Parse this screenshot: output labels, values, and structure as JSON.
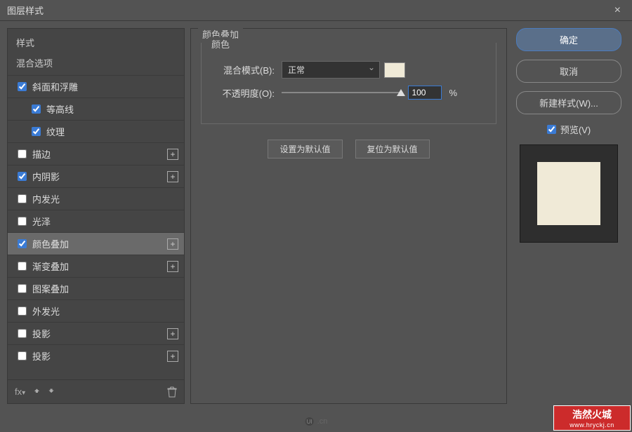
{
  "titlebar": {
    "title": "图层样式"
  },
  "sidebar": {
    "header": "样式",
    "blendOptions": "混合选项",
    "items": [
      {
        "label": "斜面和浮雕",
        "checked": true,
        "addable": false,
        "indent": 0
      },
      {
        "label": "等高线",
        "checked": true,
        "addable": false,
        "indent": 1
      },
      {
        "label": "纹理",
        "checked": true,
        "addable": false,
        "indent": 1
      },
      {
        "label": "描边",
        "checked": false,
        "addable": true,
        "indent": 0
      },
      {
        "label": "内阴影",
        "checked": true,
        "addable": true,
        "indent": 0
      },
      {
        "label": "内发光",
        "checked": false,
        "addable": false,
        "indent": 0
      },
      {
        "label": "光泽",
        "checked": false,
        "addable": false,
        "indent": 0
      },
      {
        "label": "颜色叠加",
        "checked": true,
        "addable": true,
        "indent": 0,
        "selected": true
      },
      {
        "label": "渐变叠加",
        "checked": false,
        "addable": true,
        "indent": 0
      },
      {
        "label": "图案叠加",
        "checked": false,
        "addable": false,
        "indent": 0
      },
      {
        "label": "外发光",
        "checked": false,
        "addable": false,
        "indent": 0
      },
      {
        "label": "投影",
        "checked": false,
        "addable": true,
        "indent": 0
      },
      {
        "label": "投影",
        "checked": false,
        "addable": true,
        "indent": 0
      }
    ],
    "fxLabel": "fx"
  },
  "main": {
    "groupTitle": "颜色叠加",
    "innerTitle": "颜色",
    "blendModeLabel": "混合模式(B):",
    "blendModeValue": "正常",
    "opacityLabel": "不透明度(O):",
    "opacityValue": "100",
    "opacityUnit": "%",
    "setDefault": "设置为默认值",
    "resetDefault": "复位为默认值",
    "swatchColor": "#f0ead7"
  },
  "right": {
    "ok": "确定",
    "cancel": "取消",
    "newStyle": "新建样式(W)...",
    "preview": "预览(V)",
    "previewChecked": true
  },
  "watermark": {
    "brand": "浩然火城",
    "url": "www.hryckj.cn",
    "uicn": ".cn"
  }
}
